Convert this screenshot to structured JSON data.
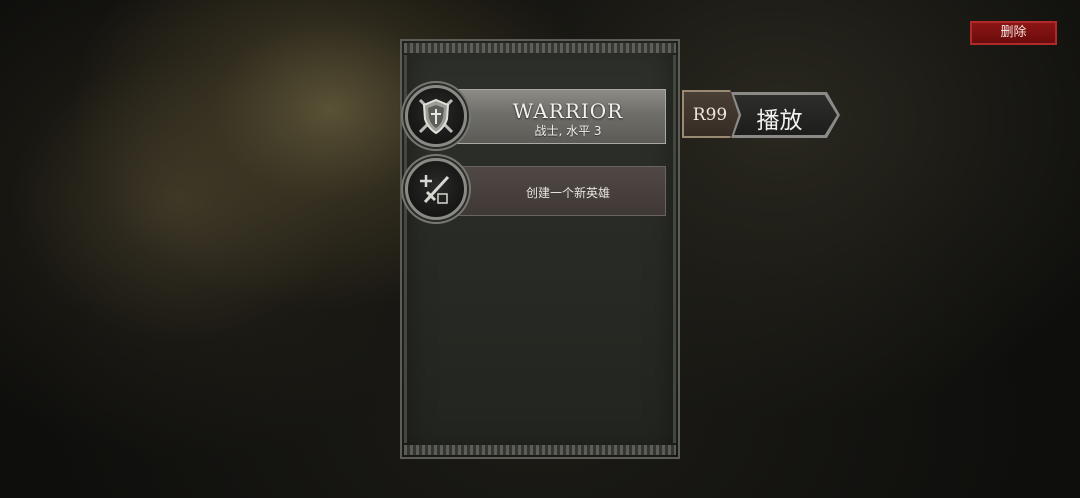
{
  "top_bar": {
    "delete_label": "删除"
  },
  "hero_list": {
    "heroes": [
      {
        "name": "WARRIOR",
        "subtitle": "战士, 水平 3",
        "icon": "shield-crossed-swords-icon",
        "selected": true
      }
    ],
    "create_slot": {
      "label": "创建一个新英雄",
      "icon": "sword-plus-icon"
    }
  },
  "selected_hero": {
    "rank": "R99",
    "play_label": "播放"
  },
  "colors": {
    "delete_button": "#7a1010",
    "panel_background": "#282a25",
    "selected_slot": "#7a7974",
    "create_slot": "#4a423e"
  }
}
